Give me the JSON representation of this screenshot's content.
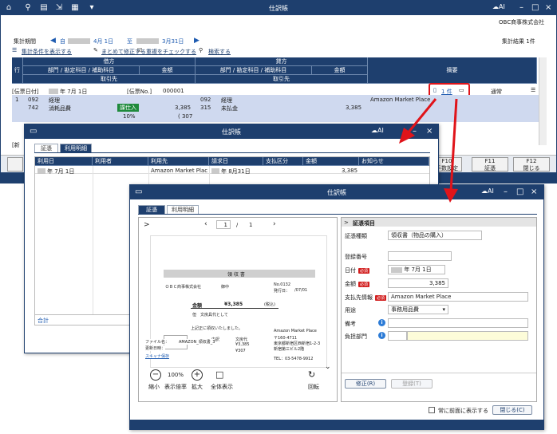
{
  "main": {
    "title": "仕訳帳",
    "company": "OBC商事株式会社",
    "period_label": "集計期間",
    "period_from": "自",
    "period_from_date": "4月 1日",
    "period_sep": "至",
    "period_to_date": "3月31日",
    "result": "集計結果 1件",
    "links": [
      "集計条件を表示する",
      "まとめて修正する",
      "重複をチェックする",
      "検索する"
    ],
    "headers": {
      "row": "行",
      "debit": "借方",
      "credit": "貸方",
      "summary": "摘要",
      "dept": "部門 / 勘定科目 / 補助科目",
      "amount": "金額",
      "partner": "取引先"
    },
    "slip": {
      "date_label": "[伝票日付]",
      "date": "年 7月 1日",
      "no_label": "[伝票No.]",
      "no": "000001",
      "attach": "1 件",
      "normal": "通常"
    },
    "row": {
      "no": "1",
      "d_dept_code": "092",
      "d_dept": "経理",
      "d_acct_code": "742",
      "d_acct": "消耗品費",
      "tax_badge": "課仕入",
      "d_amount": "3,385",
      "d_rate": "10%",
      "d_tax": "( 307",
      "c_dept_code": "092",
      "c_dept": "経理",
      "c_acct_code": "315",
      "c_acct": "未払金",
      "c_amount": "3,385",
      "summary": "Amazon Market Place"
    },
    "new_label": "[新",
    "fkeys": [
      {
        "key": "F10",
        "label": "手数設定"
      },
      {
        "key": "F11",
        "label": "証憑"
      },
      {
        "key": "F12",
        "label": "閉じる"
      }
    ]
  },
  "mid": {
    "title": "仕訳帳",
    "tabs": [
      "証憑",
      "利用明細"
    ],
    "columns": [
      "利用日",
      "利用者",
      "利用先",
      "請求日",
      "支払区分",
      "金額",
      "お知らせ"
    ],
    "row": {
      "date": "年 7月 1日",
      "user": "",
      "dest": "Amazon Market Plac",
      "bill": "年 8月31日",
      "pay": "",
      "amount": "3,385",
      "notice": ""
    },
    "total": "合計"
  },
  "front": {
    "title": "仕訳帳",
    "tabs": [
      "証憑",
      "利用明細"
    ],
    "pager": {
      "current": "1",
      "sep": "/",
      "total": "1"
    },
    "receipt": {
      "title": "領 収 書",
      "to": "ＯＢＣ商事株式会社",
      "to_suffix": "御中",
      "no_label": "No.0132",
      "date_label": "発行日：",
      "date": "/07/01",
      "amount_label": "金額",
      "amount": "¥3,385",
      "tax_incl": "(税込)",
      "desc_label": "但",
      "desc": "文房具代として",
      "confirm": "上記正に領収いたしました。",
      "issuer": "Amazon Market Place",
      "zip": "〒160-4711",
      "addr1": "東京都新宿区西新宿1-2-3",
      "addr2": "新宿第三ビル2階",
      "tel": "TEL：03-5478-9912",
      "tbl_h1": "内訳",
      "tbl_h2": "文房代",
      "tbl_r1": "¥3,385",
      "tbl_r2": "¥307",
      "file_label": "ファイル名：",
      "file": "AMAZON_領収書_3",
      "upd_label": "更新日時：",
      "scan": "スキャナ保存"
    },
    "viewer_tools": [
      {
        "icon": "−",
        "label": "縮小"
      },
      {
        "icon": "100%",
        "label": "表示倍率"
      },
      {
        "icon": "+",
        "label": "拡大"
      },
      {
        "icon": "□",
        "label": "全体表示"
      },
      {
        "icon": "↻",
        "label": "回転"
      }
    ],
    "panel": {
      "header": "証憑項目",
      "type_label": "証憑種類",
      "type": "領収書（物品の購入）",
      "reg_label": "登録番号",
      "date_label": "日付",
      "date": "年 7月 1日",
      "amount_label": "金額",
      "amount": "3,385",
      "partner_label": "支払先情報",
      "partner": "Amazon Market Place",
      "use_label": "用途",
      "use": "事務用品費",
      "memo_label": "備考",
      "dept_label": "負担部門",
      "req": "必須",
      "edit_btn": "修正(R)",
      "save_btn": "登録(T)"
    },
    "front_check": "常に前面に表示する",
    "close_btn": "閉じる(C)"
  },
  "colors": {
    "navy": "#1e3f6e",
    "selected_row": "#cfd9ef",
    "red": "#e0141a",
    "yellow": "#fdfcd9"
  }
}
